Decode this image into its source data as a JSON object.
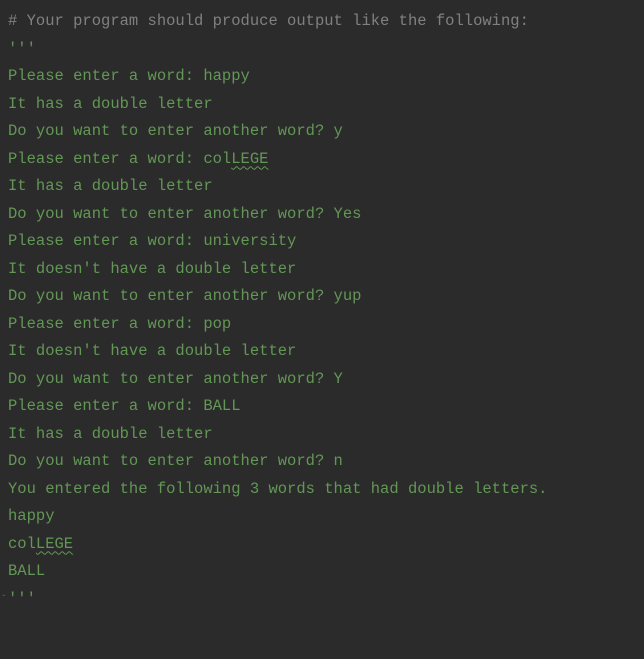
{
  "code": {
    "comment_line": "# Your program should produce output like the following:",
    "triple_open": "'''",
    "l1a": "Please enter a word: happy",
    "l2": "It has a double letter",
    "l3": "Do you want to enter another word? y",
    "l4a": "Please enter a word: col",
    "l4b": "LEGE",
    "l5": "It has a double letter",
    "l6": "Do you want to enter another word? Yes",
    "l7": "Please enter a word: university",
    "l8": "It doesn't have a double letter",
    "l9": "Do you want to enter another word? yup",
    "l10": "Please enter a word: pop",
    "l11": "It doesn't have a double letter",
    "l12": "Do you want to enter another word? Y",
    "l13": "Please enter a word: BALL",
    "l14": "It has a double letter",
    "l15": "Do you want to enter another word? n",
    "l16": "You entered the following 3 words that had double letters.",
    "l17": "happy",
    "l18a": "col",
    "l18b": "LEGE",
    "l19": "BALL",
    "triple_close": "'''"
  }
}
